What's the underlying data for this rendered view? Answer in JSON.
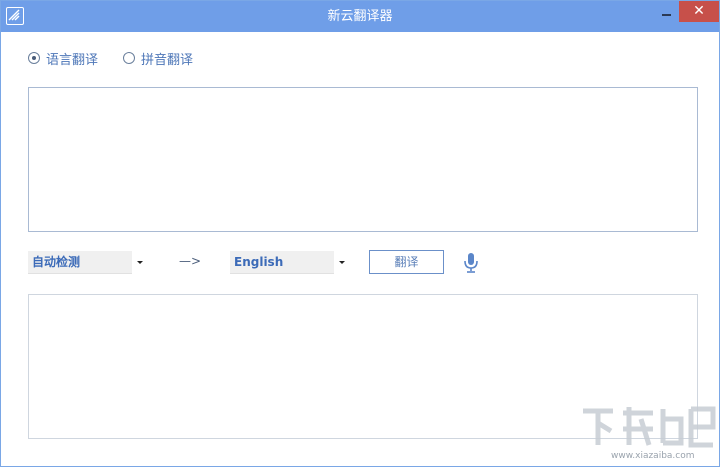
{
  "window": {
    "title": "新云翻译器",
    "close_glyph": "✕",
    "accent_color": "#6f9ee8",
    "close_color": "#c7504a"
  },
  "modes": {
    "language_label": "语言翻译",
    "pinyin_label": "拼音翻译",
    "selected": "language"
  },
  "source": {
    "text": "",
    "language": "自动检测"
  },
  "arrow": "—>",
  "target": {
    "language": "English",
    "text": ""
  },
  "translate_button": "翻译",
  "icons": {
    "app": "app-logo-icon",
    "microphone": "microphone-icon",
    "dropdown": "chevron-down-icon"
  },
  "watermark": {
    "url": "www.xiazaiba.com"
  }
}
